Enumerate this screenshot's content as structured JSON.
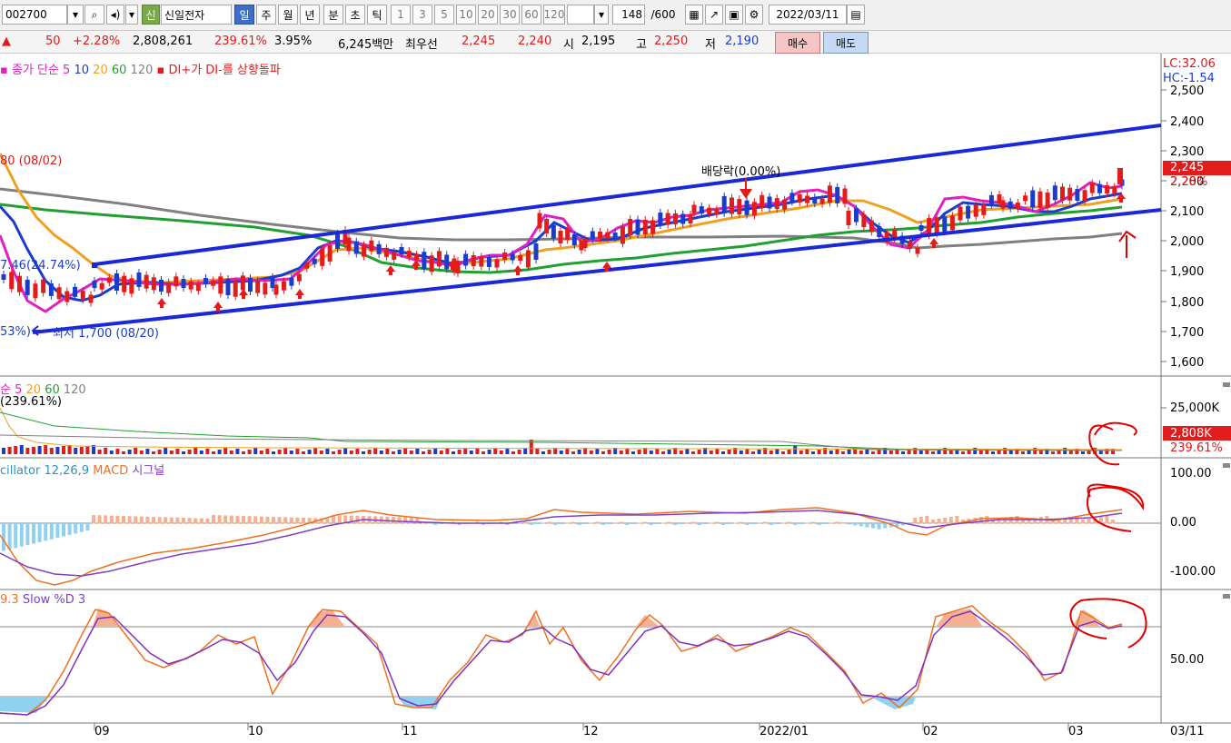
{
  "toolbar": {
    "code": "002700",
    "credit_badge": "신",
    "name": "신일전자",
    "period_tabs": [
      "일",
      "주",
      "월",
      "년",
      "분",
      "초",
      "틱"
    ],
    "active_period": "일",
    "intervals": [
      "1",
      "3",
      "5",
      "10",
      "20",
      "30",
      "60",
      "120"
    ],
    "count": "148",
    "count_total": "/600",
    "date": "2022/03/11"
  },
  "info": {
    "arrow": "▲",
    "change": "50",
    "change_pct": "+2.28%",
    "volume": "2,808,261",
    "volume_pct": "239.61%",
    "turnover": "3.95%",
    "amount": "6,245백만",
    "best_quote_label": "최우선",
    "ask": "2,245",
    "bid": "2,240",
    "open_label": "시",
    "open": "2,195",
    "high_label": "고",
    "high": "2,250",
    "low_label": "저",
    "low": "2,190",
    "buy": "매수",
    "sell": "매도"
  },
  "price_panel": {
    "legend_main": "종가 단순 5",
    "legend_ma": [
      "10",
      "20",
      "60",
      "120"
    ],
    "legend_signal": "DI+가 DI-를 상향돌파",
    "high_note": "80 (08/02)",
    "mid_note": "7.46(24.74%)",
    "low_note_pct": "53%)",
    "low_note": "최저 1,700 (08/20)",
    "dividend": "배당락(0.00%)",
    "lc": "LC:32.06",
    "hc": "HC:-1.54",
    "y_ticks": [
      "2,500",
      "2,400",
      "2,300",
      "2,200",
      "2,100",
      "2,000",
      "1,900",
      "1,800",
      "1,700",
      "1,600"
    ],
    "current": "2,245",
    "current_pct": "2.28%"
  },
  "volume_panel": {
    "legend_main": "순 5",
    "legend_ma": [
      "20",
      "60",
      "120"
    ],
    "legend_sub": "239.61%)",
    "y_tick": "25,000K",
    "current": "2,808K",
    "current_pct": "239.61%"
  },
  "macd_panel": {
    "legend_osc": "cillator 12,26,9",
    "legend_macd": "MACD",
    "legend_signal": "시그널",
    "y_ticks": [
      "100.00",
      "0.00",
      "-100.00"
    ]
  },
  "stoch_panel": {
    "legend_k": "9.3",
    "legend_d": "Slow %D 3",
    "y_tick": "50.00"
  },
  "x_axis": [
    "09",
    "10",
    "11",
    "12",
    "2022/01",
    "02",
    "03"
  ],
  "x_last": "03/11",
  "colors": {
    "up": "#e21b1b",
    "down": "#1a3ccc",
    "ma5": "#e020c0",
    "ma10": "#1a3ccc",
    "ma20": "#f0a020",
    "ma60": "#20a030",
    "ma120": "#808080",
    "channel": "#1a28d8",
    "annotation": "#e00000"
  }
}
